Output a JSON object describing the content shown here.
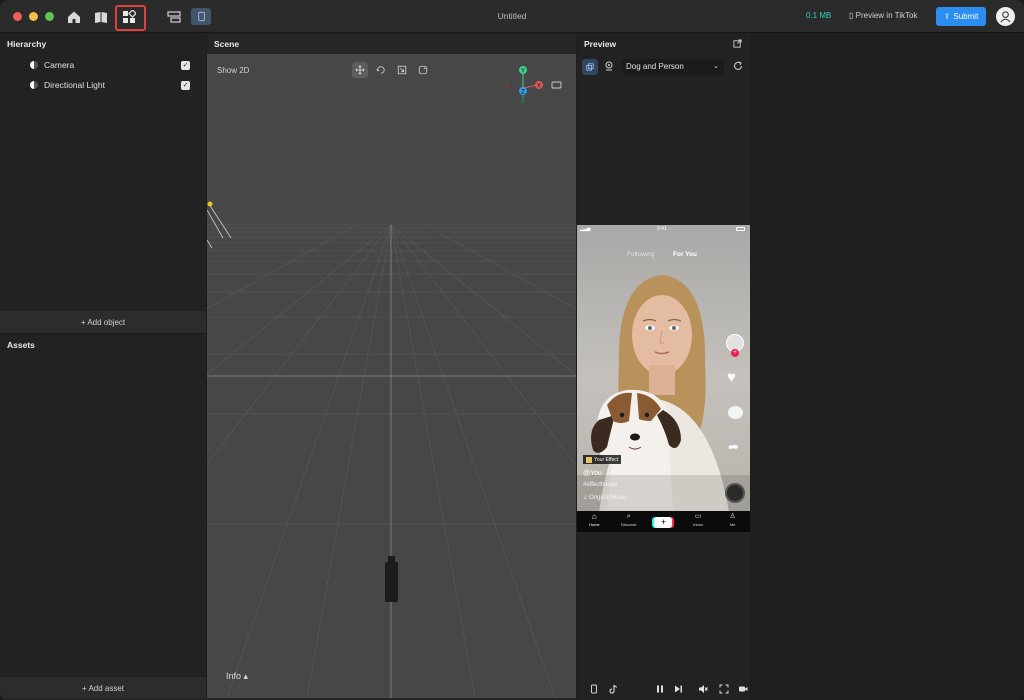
{
  "window": {
    "title": "Untitled"
  },
  "toolbar": {
    "size_label": "0.1 MB",
    "preview_label": "Preview in TikTok",
    "submit_label": "Submit"
  },
  "hierarchy": {
    "title": "Hierarchy",
    "items": [
      {
        "label": "Camera",
        "visible": true
      },
      {
        "label": "Directional Light",
        "visible": true
      }
    ],
    "add_label": "+ Add object"
  },
  "assets": {
    "title": "Assets",
    "add_label": "+ Add asset"
  },
  "scene": {
    "title": "Scene",
    "show2d_label": "Show 2D",
    "info_label": "Info ▴",
    "gizmo": {
      "y": "Y",
      "x": "X",
      "z": "Z"
    }
  },
  "preview": {
    "title": "Preview",
    "selected_option": "Dog and Person",
    "phone": {
      "time": "9:41",
      "tab_following": "Following",
      "tab_for_you": "For You",
      "effect_badge": "Your Effect",
      "username": "@You",
      "hashtag": "#effecthouse",
      "music": "Original Music",
      "nav": [
        "Home",
        "Discover",
        "",
        "Inbox",
        "Me"
      ]
    }
  },
  "colors": {
    "accent": "#2a8ef0",
    "size": "#2fd0b8",
    "highlight": "#e0403c"
  }
}
